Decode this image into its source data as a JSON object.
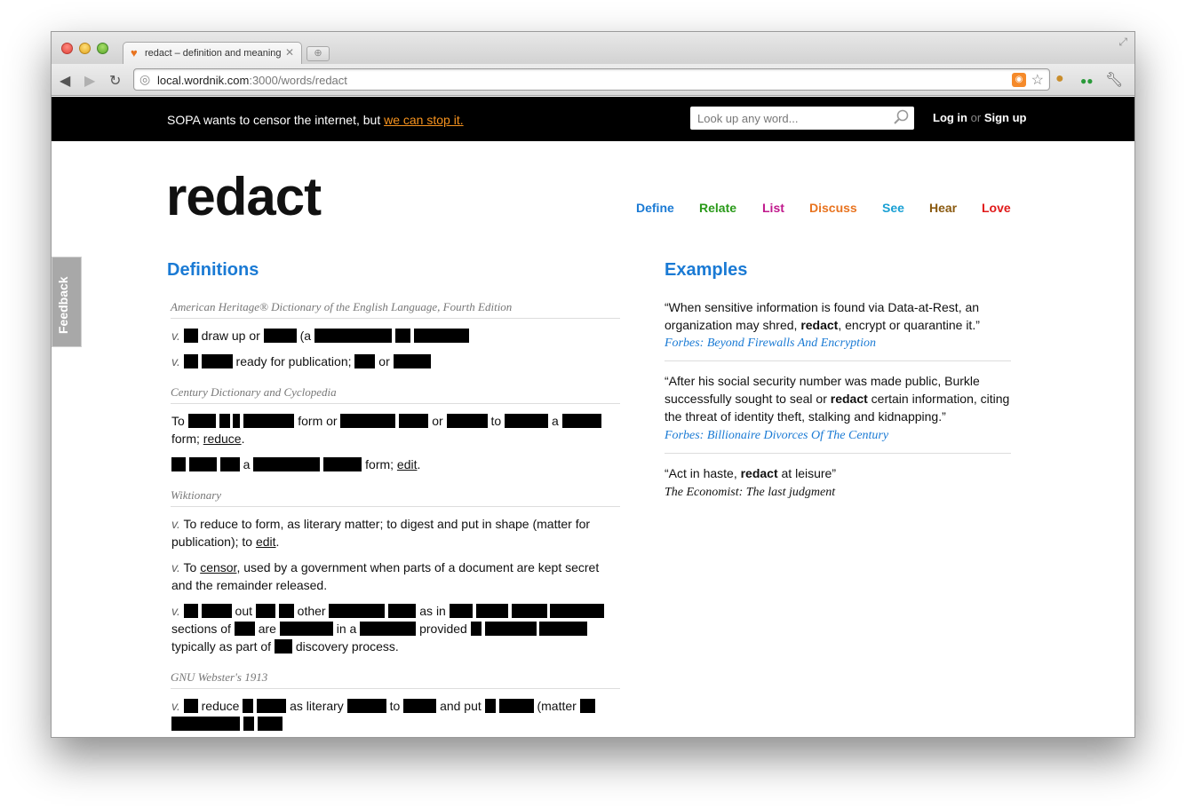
{
  "browser": {
    "tab_title": "redact – definition and meaning",
    "tab_close": "✕",
    "new_tab": "⊕",
    "url_host": "local.wordnik.com",
    "url_path": ":3000/words/redact"
  },
  "banner": {
    "text": "SOPA wants to censor the internet, but ",
    "link": "we can stop it.",
    "search_placeholder": "Look up any word...",
    "login": "Log in",
    "or": "or",
    "signup": "Sign up"
  },
  "word": "redact",
  "nav": [
    {
      "label": "Define",
      "color": "#1a7ad4"
    },
    {
      "label": "Relate",
      "color": "#2a9a1a"
    },
    {
      "label": "List",
      "color": "#c0188c"
    },
    {
      "label": "Discuss",
      "color": "#e8731f"
    },
    {
      "label": "See",
      "color": "#1aa0d4"
    },
    {
      "label": "Hear",
      "color": "#8a5a10"
    },
    {
      "label": "Love",
      "color": "#e01a1a"
    }
  ],
  "feedback": "Feedback",
  "definitions": {
    "heading": "Definitions",
    "pos": "v.",
    "sources": [
      "American Heritage® Dictionary of the English Language, Fourth Edition",
      "Century Dictionary and Cyclopedia",
      "Wiktionary",
      "GNU Webster's 1913"
    ],
    "ah1": [
      "draw up or",
      "(a"
    ],
    "ah2": [
      "ready for publication;",
      "or"
    ],
    "cd1": [
      "To",
      "form or",
      "or",
      "to",
      "a",
      "form;",
      "reduce",
      "."
    ],
    "cd2": [
      "a",
      "form;",
      "edit",
      "."
    ],
    "wk1": [
      "To reduce to form, as literary matter; to digest and put in shape (matter for publication); to",
      "edit",
      "."
    ],
    "wk2": [
      "To",
      "censor",
      ", used by a government when parts of a document are kept secret and the remainder released."
    ],
    "wk3": [
      "out",
      "other",
      "as in",
      "sections of",
      "are",
      "in a",
      "provided",
      "typically as part of",
      "discovery process."
    ],
    "gw1": [
      "reduce",
      "as literary",
      "to",
      "and put",
      "(matter"
    ]
  },
  "examples": {
    "heading": "Examples",
    "items": [
      {
        "pre": "“When sensitive information is found via Data-at-Rest, an organization may shred, ",
        "bold": "redact",
        "post": ", encrypt or quarantine it.”",
        "source": "Forbes: Beyond Firewalls And Encryption"
      },
      {
        "pre": "“After his social security number was made public, Burkle successfully sought to seal or ",
        "bold": "redact",
        "post": " certain information, citing the threat of identity theft, stalking and kidnapping.”",
        "source": "Forbes: Billionaire Divorces Of The Century"
      },
      {
        "pre": "“Act in haste, ",
        "bold": "redact",
        "post": " at leisure”",
        "source": "The Economist: The last judgment"
      }
    ]
  }
}
